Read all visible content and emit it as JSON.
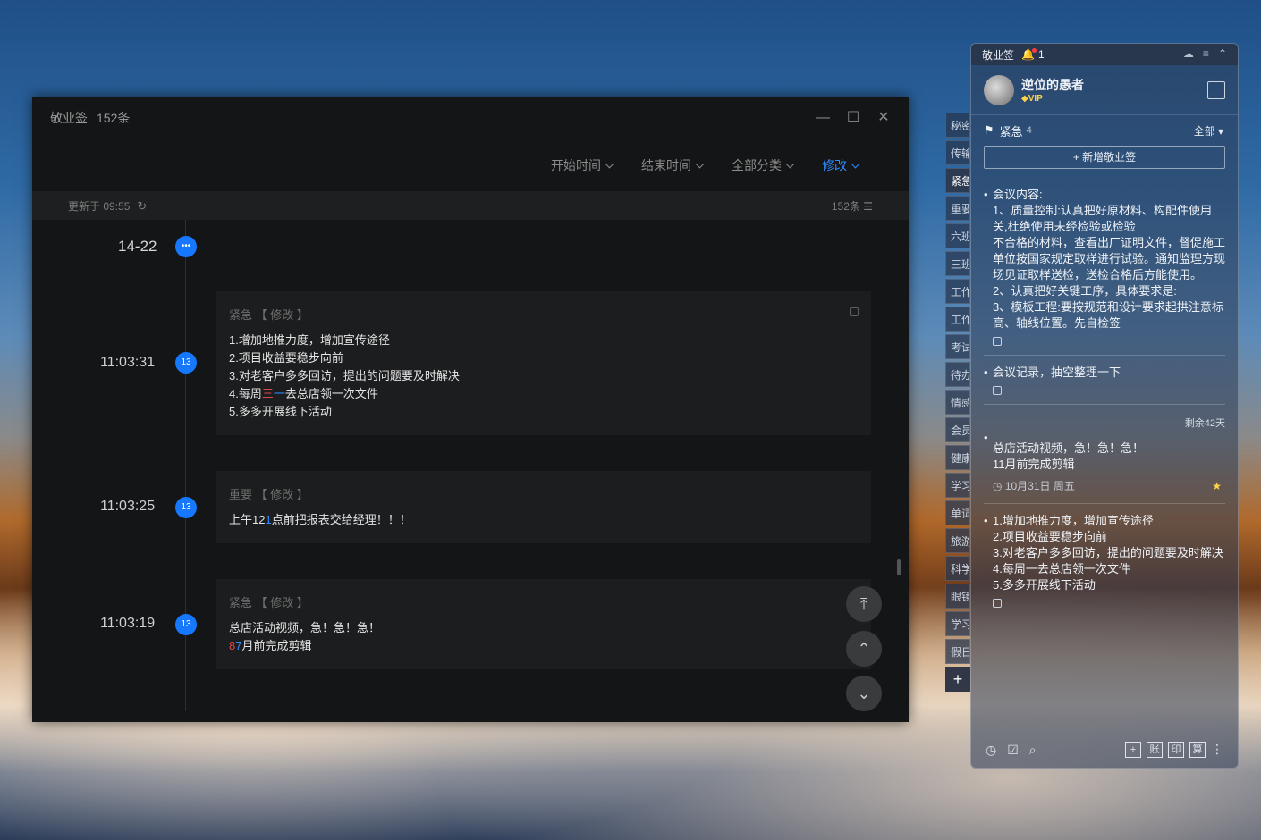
{
  "main": {
    "app_name": "敬业签",
    "count": "152条",
    "filters": [
      "开始时间",
      "结束时间",
      "全部分类",
      "修改"
    ],
    "status": {
      "updated": "更新于 09:55",
      "count": "152条"
    },
    "timeline": {
      "date": "14-22",
      "entries": [
        {
          "time": "11:03:31",
          "badge": "13",
          "head": "紧急 【 修改 】",
          "lines": [
            "1.增加地推力度，增加宣传途径",
            "2.项目收益要稳步向前",
            "3.对老客户多多回访，提出的问题要及时解决",
            "4.每周",
            "三",
            "一",
            "去总店领一次文件",
            "5.多多开展线下活动"
          ]
        },
        {
          "time": "11:03:25",
          "badge": "13",
          "head": "重要 【 修改 】",
          "lines": [
            "上午12",
            "1",
            "点前把报表交给经理！！！"
          ]
        },
        {
          "time": "11:03:19",
          "badge": "13",
          "head": "紧急 【 修改 】",
          "lines": [
            "总店活动视频，急！急！急！",
            "8",
            "7",
            "月前完成剪辑"
          ]
        }
      ]
    }
  },
  "side_tabs": [
    "秘密",
    "传输",
    "紧急",
    "重要",
    "六班",
    "三班",
    "工作",
    "工作",
    "考试",
    "待办",
    "情感",
    "会员",
    "健康",
    "学习",
    "单词",
    "旅游",
    "科学",
    "眼镜",
    "学习",
    "假日"
  ],
  "panel": {
    "app_name": "敬业签",
    "bell_count": "1",
    "user_name": "逆位的愚者",
    "vip": "VIP",
    "category": "紧急",
    "category_count": "4",
    "all_label": "全部",
    "new_button": "+ 新增敬业签",
    "notes": [
      {
        "lines": [
          "会议内容:",
          "1、质量控制:认真把好原材料、构配件使用关,杜绝使用未经检验或检验",
          "不合格的材料，查看出厂证明文件，督促施工单位按国家规定取样进行试验。通知监理方现场见证取样送检，送检合格后方能使用。",
          "2、认真把好关键工序，具体要求是:",
          "3、模板工程:要按规范和设计要求起拱注意标高、轴线位置。先自检签"
        ]
      },
      {
        "lines": [
          "会议记录，抽空整理一下"
        ]
      },
      {
        "remaining": "剩余42天",
        "lines": [
          "总店活动视频，急！急！急！",
          "11月前完成剪辑"
        ],
        "date": "10月31日 周五"
      },
      {
        "lines": [
          "1.增加地推力度，增加宣传途径",
          "2.项目收益要稳步向前",
          "3.对老客户多多回访，提出的问题要及时解决",
          "4.每周一去总店领一次文件",
          "5.多多开展线下活动"
        ]
      }
    ],
    "bottom_boxes": [
      "+",
      "账",
      "印",
      "算"
    ]
  }
}
